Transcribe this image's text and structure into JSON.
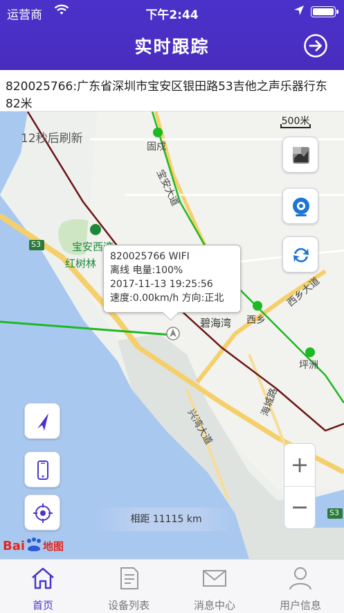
{
  "status_bar": {
    "carrier": "运营商",
    "time": "下午2:44"
  },
  "nav": {
    "title": "实时跟踪"
  },
  "address": {
    "text": "820025766:广东省深圳市宝安区银田路53吉他之声乐器行东82米"
  },
  "map": {
    "refresh_text": "12秒后刷新",
    "scale_label": "500米",
    "distance_label": "相距 11115 km",
    "logo_text": "Bai",
    "logo_text2": "地图",
    "labels": {
      "gu_shu": "固戍",
      "baoan_dadao": "宝安大道",
      "baoan_park_1": "宝安西湾",
      "baoan_park_2": "红树林",
      "s3_a": "S3",
      "s3_b": "S3",
      "bi_hai_wan": "碧海湾",
      "xi_xiang": "西乡",
      "xixiang_dadao": "西乡大道",
      "ping_zhou": "坪洲",
      "haicheng_road": "海城路",
      "xingwan_dadao": "兴湾大道"
    }
  },
  "device_popup": {
    "line1": "820025766  WIFI",
    "line2": "离线 电量:100%",
    "line3": "2017-11-13 19:25:56",
    "line4": "速度:0.00km/h 方向:正北"
  },
  "controls": {
    "zoom_in": "+",
    "zoom_out": "−"
  },
  "tabs": [
    {
      "label": "首页",
      "active": true
    },
    {
      "label": "设备列表",
      "active": false
    },
    {
      "label": "消息中心",
      "active": false
    },
    {
      "label": "用户信息",
      "active": false
    }
  ],
  "colors": {
    "nav_bg": "#4a31c9",
    "accent": "#4a35c8",
    "track_green": "#1db924",
    "track_darkred": "#6b1414"
  }
}
